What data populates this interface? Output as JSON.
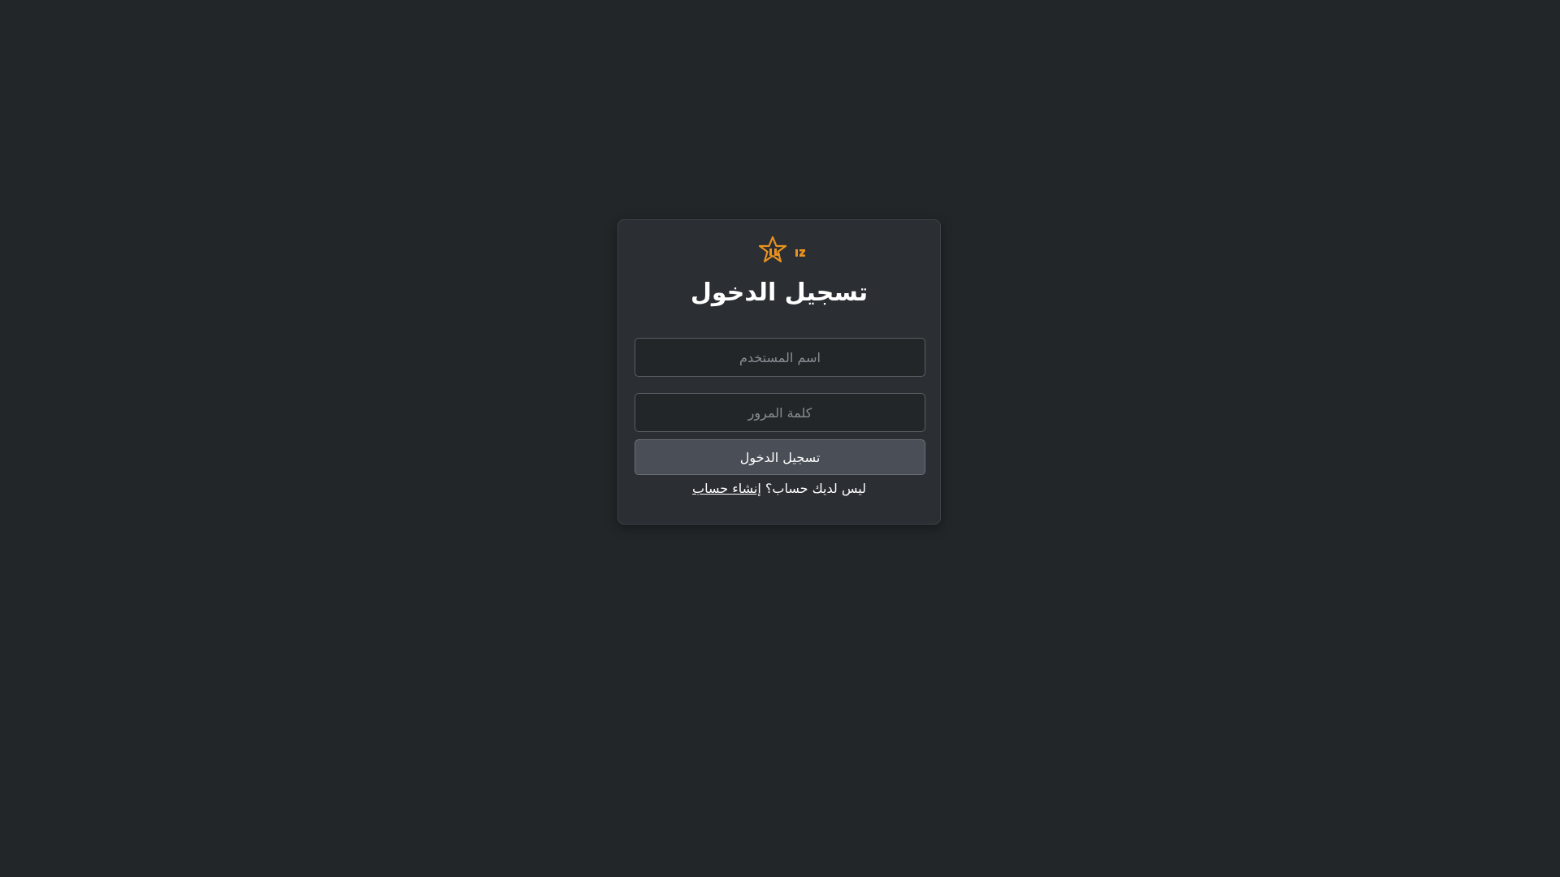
{
  "logo": {
    "icon": "star-logo-icon",
    "color": "#e8921f"
  },
  "login": {
    "title": "تسجيل الدخول",
    "username_placeholder": "اسم المستخدم",
    "password_placeholder": "كلمة المرور",
    "submit_label": "تسجيل الدخول",
    "signup_prompt": "ليس لديك حساب؟",
    "signup_link": "إنشاء حساب"
  },
  "colors": {
    "background": "#222629",
    "card": "#2b2e33",
    "button": "#4a4e56"
  }
}
